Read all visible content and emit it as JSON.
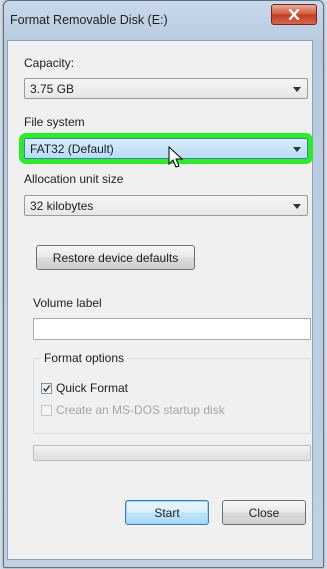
{
  "window": {
    "title": "Format Removable Disk (E:)"
  },
  "capacity": {
    "label": "Capacity:",
    "value": "3.75 GB"
  },
  "file_system": {
    "label": "File system",
    "value": "FAT32 (Default)"
  },
  "allocation": {
    "label": "Allocation unit size",
    "value": "32 kilobytes"
  },
  "restore_button": "Restore device defaults",
  "volume_label": {
    "label": "Volume label",
    "value": ""
  },
  "format_options": {
    "title": "Format options",
    "quick_format": {
      "label": "Quick Format",
      "checked": true
    },
    "msdos_disk": {
      "label": "Create an MS-DOS startup disk",
      "checked": false,
      "enabled": false
    }
  },
  "progress": {
    "value": 0
  },
  "buttons": {
    "start": "Start",
    "close": "Close"
  },
  "colors": {
    "highlight": "#2dea2a",
    "close_button": "#c23c21"
  }
}
